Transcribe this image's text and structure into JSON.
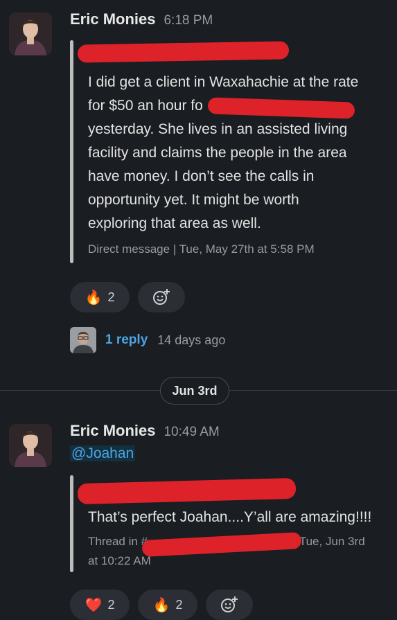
{
  "message1": {
    "author": "Eric Monies",
    "time": "6:18 PM",
    "quote_lines": [
      "I did get a client in Waxahachie at the rate",
      "for $50 an hour fo",
      "yesterday. She lives in an assisted living",
      "facility and claims the people in the area",
      "have money. I don’t see the calls in",
      "opportunity yet. It might be worth",
      "exploring that area as well."
    ],
    "quote_meta": "Direct message | Tue, May 27th at 5:58 PM",
    "reactions": [
      {
        "emoji": "🔥",
        "count": "2"
      }
    ],
    "replies": {
      "label": "1 reply",
      "age": "14 days ago"
    }
  },
  "date_divider": "Jun 3rd",
  "message2": {
    "author": "Eric Monies",
    "time": "10:49 AM",
    "mention": "@Joahan",
    "quote_text": "That’s perfect Joahan....Y’all are amazing!!!!",
    "quote_meta_prefix": "Thread in #",
    "quote_meta_suffix": "| Tue, Jun 3rd",
    "quote_meta_line2": "at 10:22 AM",
    "reactions": [
      {
        "emoji": "❤️",
        "count": "2"
      },
      {
        "emoji": "🔥",
        "count": "2"
      }
    ]
  },
  "colors": {
    "background": "#1a1d21",
    "link": "#4ea6e6",
    "redaction": "#e8242a"
  }
}
